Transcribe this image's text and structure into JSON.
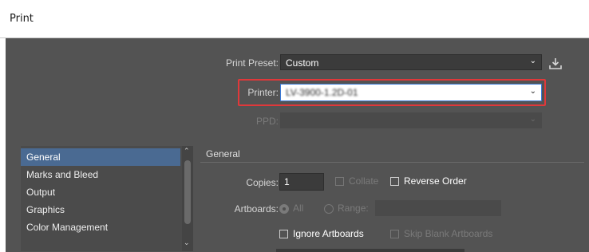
{
  "window": {
    "title": "Print"
  },
  "preset": {
    "label": "Print Preset:",
    "value": "Custom"
  },
  "printer": {
    "label": "Printer:",
    "value": "LV-3900-1.2D-01"
  },
  "ppd": {
    "label": "PPD:",
    "value": ""
  },
  "sidebar": {
    "items": [
      {
        "label": "General"
      },
      {
        "label": "Marks and Bleed"
      },
      {
        "label": "Output"
      },
      {
        "label": "Graphics"
      },
      {
        "label": "Color Management"
      }
    ],
    "selected": "General"
  },
  "general": {
    "header": "General",
    "copies_label": "Copies:",
    "copies_value": "1",
    "collate_label": "Collate",
    "reverse_order_label": "Reverse Order",
    "artboards_label": "Artboards:",
    "all_label": "All",
    "range_label": "Range:",
    "ignore_artboards_label": "Ignore Artboards",
    "skip_blank_label": "Skip Blank Artboards"
  },
  "colors": {
    "dialog_bg": "#535353",
    "highlight": "#e0383a",
    "selected_item": "#4a6a92",
    "focus_border": "#3b7ad6"
  },
  "icons": {
    "chevron": "chevron-down-icon",
    "save_preset": "download-icon"
  }
}
